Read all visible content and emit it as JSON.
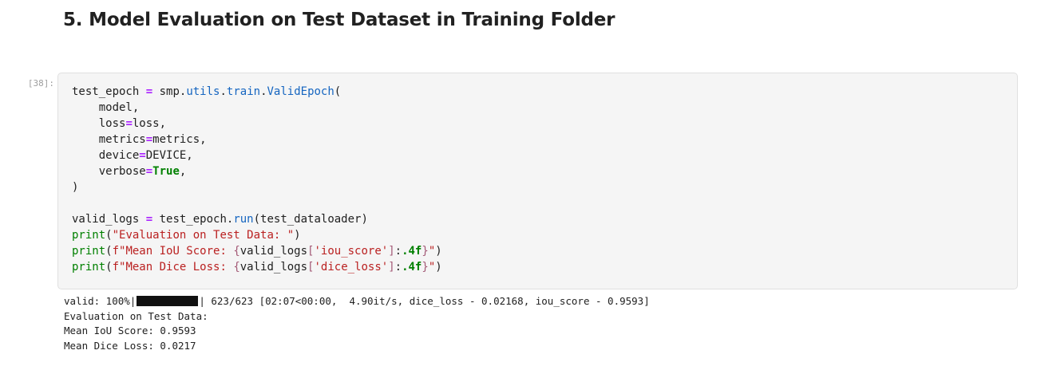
{
  "heading": "5. Model Evaluation on Test Dataset in Training Folder",
  "cell": {
    "prompt": "[38]:",
    "code": {
      "l1_a": "test_epoch ",
      "l1_eq": "=",
      "l1_b": " smp.",
      "l1_utils": "utils",
      "l1_dot1": ".",
      "l1_train": "train",
      "l1_dot2": ".",
      "l1_valid": "ValidEpoch",
      "l1_paren": "(",
      "l2": "    model,",
      "l3_a": "    loss",
      "l3_eq": "=",
      "l3_b": "loss,",
      "l4_a": "    metrics",
      "l4_eq": "=",
      "l4_b": "metrics,",
      "l5_a": "    device",
      "l5_eq": "=",
      "l5_b": "DEVICE,",
      "l6_a": "    verbose",
      "l6_eq": "=",
      "l6_true": "True",
      "l6_b": ",",
      "l7": ")",
      "l9_a": "valid_logs ",
      "l9_eq": "=",
      "l9_b": " test_epoch.",
      "l9_run": "run",
      "l9_c": "(test_dataloader)",
      "l10_print": "print",
      "l10_open": "(",
      "l10_str": "\"Evaluation on Test Data: \"",
      "l10_close": ")",
      "l11_print": "print",
      "l11_open": "(",
      "l11_str1": "f\"Mean IoU Score: ",
      "l11_brace1": "{",
      "l11_var": "valid_logs",
      "l11_br1": "[",
      "l11_key": "'iou_score'",
      "l11_br2": "]",
      "l11_colon": ":",
      "l11_fmt": ".4f",
      "l11_brace2": "}",
      "l11_str2": "\"",
      "l11_close": ")",
      "l12_print": "print",
      "l12_open": "(",
      "l12_str1": "f\"Mean Dice Loss: ",
      "l12_brace1": "{",
      "l12_var": "valid_logs",
      "l12_br1": "[",
      "l12_key": "'dice_loss'",
      "l12_br2": "]",
      "l12_colon": ":",
      "l12_fmt": ".4f",
      "l12_brace2": "}",
      "l12_str2": "\"",
      "l12_close": ")"
    }
  },
  "output": {
    "progress_prefix": "valid: 100%|",
    "progress_value": 1.0,
    "progress_suffix": "| 623/623 [02:07<00:00,  4.90it/s, dice_loss - 0.02168, iou_score - 0.9593]",
    "line2": "Evaluation on Test Data:",
    "line3": "Mean IoU Score: 0.9593",
    "line4": "Mean Dice Loss: 0.0217"
  }
}
